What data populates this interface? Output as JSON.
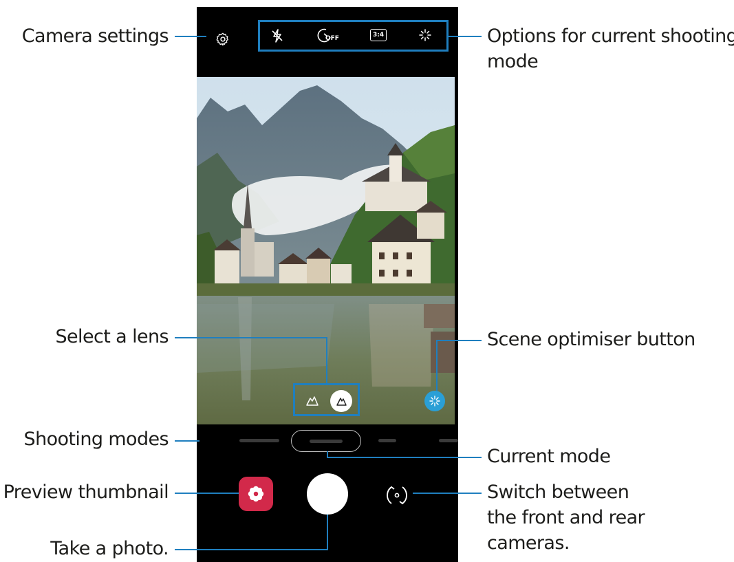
{
  "callouts": {
    "camera_settings": "Camera settings",
    "options_line1": "Options for current shooting",
    "options_line2": "mode",
    "select_lens": "Select a lens",
    "scene_optimiser": "Scene optimiser button",
    "shooting_modes": "Shooting modes",
    "current_mode": "Current mode",
    "preview_thumbnail": "Preview thumbnail",
    "switch_line1": "Switch between",
    "switch_line2": "the front and rear",
    "switch_line3": "cameras.",
    "take_photo": "Take a photo."
  },
  "topbar": {
    "flash_icon": "flash-off-icon",
    "timer_label": "OFF",
    "ratio_label": "3:4",
    "filter_icon": "sparkle-icon"
  },
  "lens": {
    "options": [
      "wide-angle-lens-icon",
      "standard-lens-icon"
    ],
    "selected": "standard-lens-icon"
  },
  "colors": {
    "callout_line": "#1f7fbf",
    "scene_optimiser": "#2a9fd6",
    "gallery_thumbnail": "#d2294a"
  }
}
